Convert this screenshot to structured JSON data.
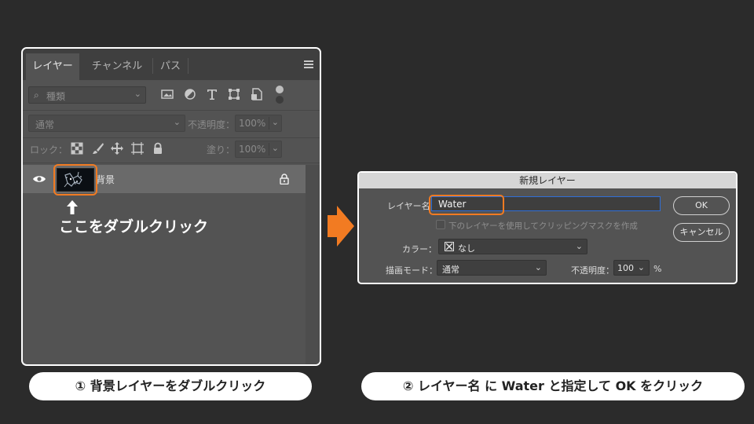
{
  "layers_panel": {
    "tabs": [
      "レイヤー",
      "チャンネル",
      "パス"
    ],
    "filter": {
      "placeholder": "種類"
    },
    "blend_mode": "通常",
    "opacity_label": "不透明度：",
    "opacity_value": "100%",
    "lock_label": "ロック：",
    "fill_label": "塗り：",
    "fill_value": "100%",
    "layer": {
      "name": "背景"
    },
    "instruction": "ここをダブルクリック"
  },
  "dialog": {
    "title": "新規レイヤー",
    "name_label": "レイヤー名",
    "name_value": "Water",
    "clipping_label": "下のレイヤーを使用してクリッピングマスクを作成",
    "color_label": "カラー：",
    "color_value": "なし",
    "mode_label": "描画モード：",
    "mode_value": "通常",
    "opacity_label": "不透明度：",
    "opacity_value": "100",
    "percent": "%",
    "ok_label": "OK",
    "cancel_label": "キャンセル"
  },
  "captions": {
    "step1": "① 背景レイヤーをダブルクリック",
    "step2": "② レイヤー名 に Water と指定して OK をクリック"
  },
  "colors": {
    "highlight": "#f27b22",
    "arrow": "#f27b22",
    "focus": "#2f6fd8"
  }
}
